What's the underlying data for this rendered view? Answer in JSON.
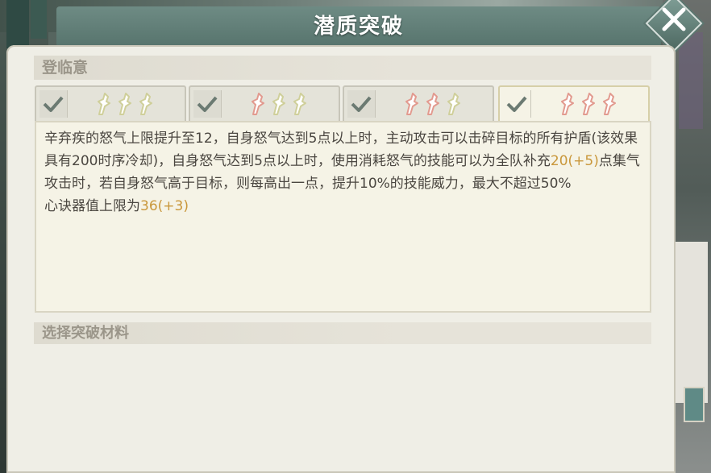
{
  "window": {
    "title": "潜质突破",
    "close_icon": "close-x-icon"
  },
  "sections": {
    "current_name": "登临意",
    "materials_heading": "选择突破材料"
  },
  "tabs": [
    {
      "checked": true,
      "gems_lit": 0,
      "gems_total": 3
    },
    {
      "checked": true,
      "gems_lit": 1,
      "gems_total": 3
    },
    {
      "checked": true,
      "gems_lit": 2,
      "gems_total": 3
    },
    {
      "checked": true,
      "gems_lit": 3,
      "gems_total": 3,
      "active": true
    }
  ],
  "description": {
    "line1_a": "辛弃疾的怒气上限提升至12，自身怒气达到5点以上时，主动攻击可以击碎目标的所有护盾(该效果具有200时序冷却)，自身怒气达到5点以上时，使用消耗怒气的技能可以为全队补充",
    "line1_value": "20(+5)",
    "line1_b": "点集气",
    "line2": "攻击时，若自身怒气高于目标，则每高出一点，提升10%的技能威力，最大不超过50%",
    "line3_a": "心诀器值上限为",
    "line3_value": "36(+3)"
  },
  "colors": {
    "highlight": "#c9973b",
    "gem_lit": "#e29a8f",
    "gem_unlit": "#cfcf9a",
    "check": "#6b7a72"
  }
}
